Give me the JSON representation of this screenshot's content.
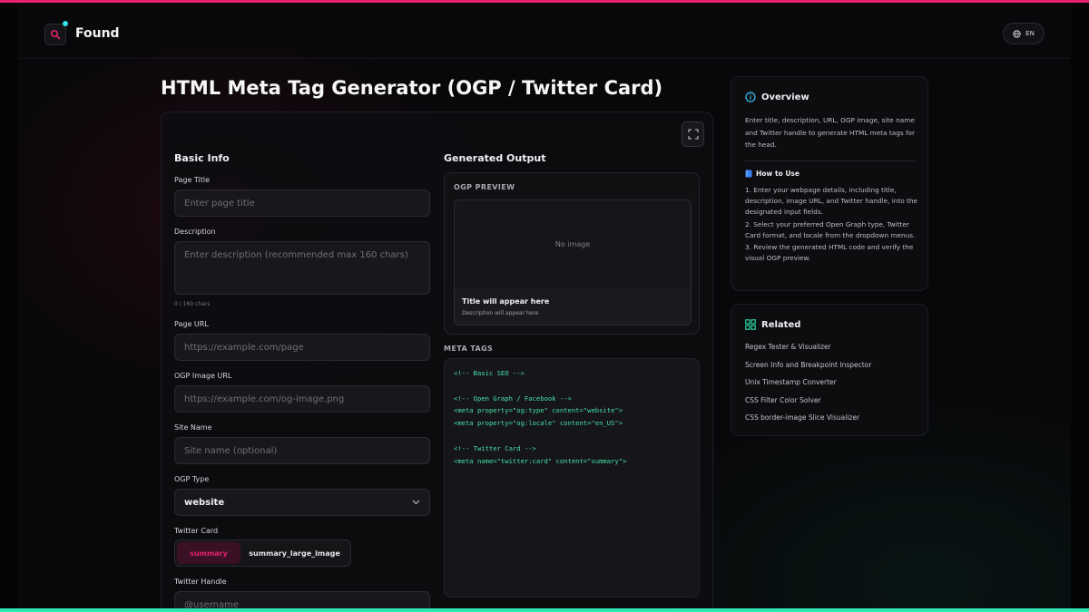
{
  "header": {
    "logo_text": "Found",
    "lang_label": "EN"
  },
  "page": {
    "title": "HTML Meta Tag Generator (OGP / Twitter Card)"
  },
  "form": {
    "heading": "Basic Info",
    "page_title": {
      "label": "Page Title",
      "placeholder": "Enter page title"
    },
    "description": {
      "label": "Description",
      "placeholder": "Enter description (recommended max 160 chars)",
      "counter": "0 / 160 chars"
    },
    "page_url": {
      "label": "Page URL",
      "placeholder": "https://example.com/page"
    },
    "ogp_image_url": {
      "label": "OGP Image URL",
      "placeholder": "https://example.com/og-image.png"
    },
    "site_name": {
      "label": "Site Name",
      "placeholder": "Site name (optional)"
    },
    "ogp_type": {
      "label": "OGP Type",
      "value": "website"
    },
    "twitter_card": {
      "label": "Twitter Card",
      "options": [
        "summary",
        "summary_large_image"
      ],
      "selected": "summary"
    },
    "twitter_handle": {
      "label": "Twitter Handle",
      "placeholder": "@username"
    }
  },
  "output": {
    "heading": "Generated Output",
    "ogp_preview_label": "OGP PREVIEW",
    "no_image_text": "No image",
    "preview_title": "Title will appear here",
    "preview_description": "Description will appear here",
    "meta_tags_label": "META TAGS",
    "code": "<!-- Basic SEO -->\n\n<!-- Open Graph / Facebook -->\n<meta property=\"og:type\" content=\"website\">\n<meta property=\"og:locale\" content=\"en_US\">\n\n<!-- Twitter Card -->\n<meta name=\"twitter:card\" content=\"summary\">"
  },
  "overview": {
    "heading": "Overview",
    "text": "Enter title, description, URL, OGP image, site name and Twitter handle to generate HTML meta tags for the head.",
    "howto_heading": "How to Use",
    "steps": [
      "1. Enter your webpage details, including title, description, image URL, and Twitter handle, into the designated input fields.",
      "2. Select your preferred Open Graph type, Twitter Card format, and locale from the dropdown menus.",
      "3. Review the generated HTML code and verify the visual OGP preview."
    ]
  },
  "related": {
    "heading": "Related",
    "items": [
      "Regex Tester & Visualizer",
      "Screen Info and Breakpoint Inspector",
      "Unix Timestamp Converter",
      "CSS Filter Color Solver",
      "CSS border-image Slice Visualizer"
    ]
  },
  "colors": {
    "accent_pink": "#e6216f",
    "accent_teal": "#2ee6b0",
    "code_green": "#46e0a6",
    "info_blue": "#38bdf8"
  }
}
